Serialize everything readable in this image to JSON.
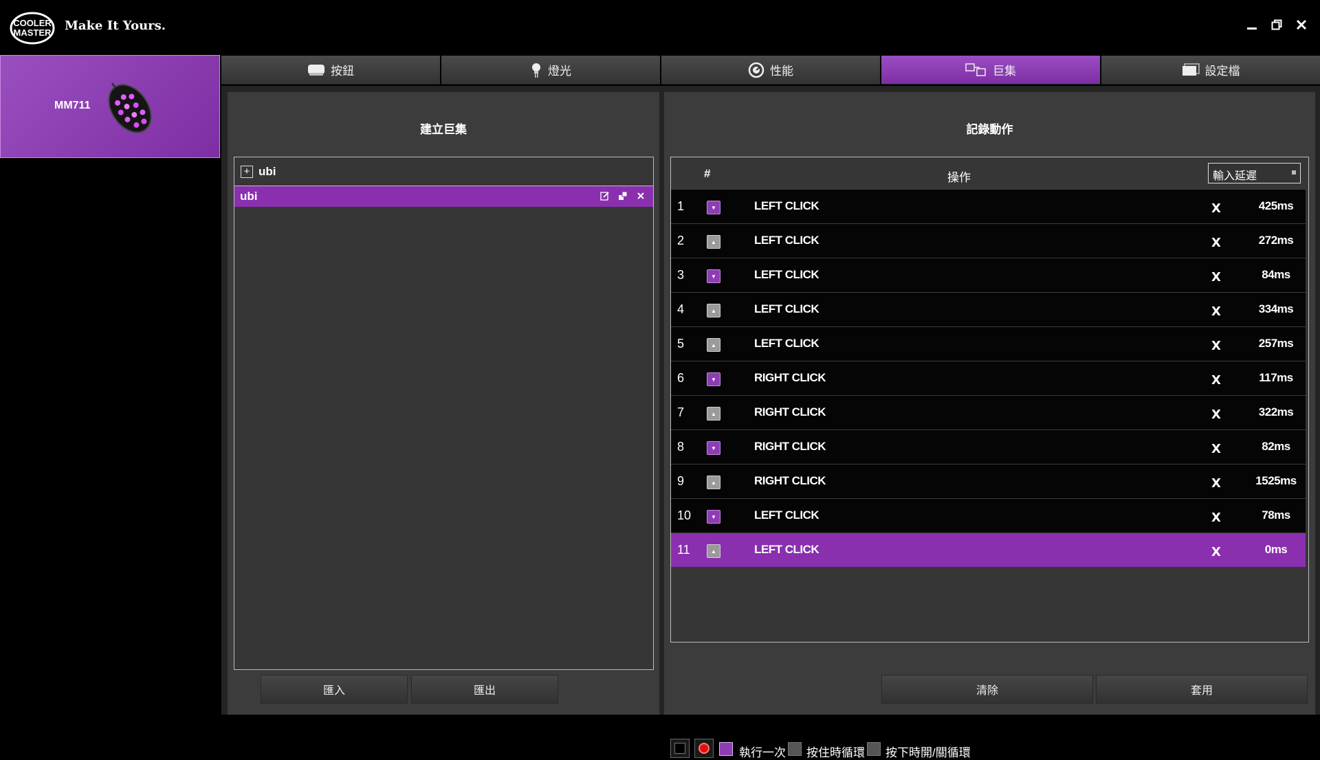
{
  "header": {
    "brand_line1": "COOLER",
    "brand_line2": "MASTER",
    "tagline": "Make It Yours.",
    "window_controls": [
      "minimize-icon",
      "restore-icon",
      "close-icon"
    ]
  },
  "device": {
    "name": "MM711"
  },
  "tabs": [
    {
      "label": "按鈕",
      "icon": "button-icon",
      "active": false
    },
    {
      "label": "燈光",
      "icon": "lighting-icon",
      "active": false
    },
    {
      "label": "性能",
      "icon": "performance-icon",
      "active": false
    },
    {
      "label": "巨集",
      "icon": "macro-icon",
      "active": true
    },
    {
      "label": "設定檔",
      "icon": "profile-icon",
      "active": false
    }
  ],
  "left_panel": {
    "title": "建立巨集",
    "group_name": "ubi",
    "selected_macro": "ubi",
    "import_label": "匯入",
    "export_label": "匯出"
  },
  "right_panel": {
    "title": "記錄動作",
    "col_hash": "#",
    "col_action": "操作",
    "delay_select": "輸入延遲",
    "rows": [
      {
        "num": "1",
        "type": "down",
        "action": "LEFT CLICK",
        "delay": "425ms"
      },
      {
        "num": "2",
        "type": "up",
        "action": "LEFT CLICK",
        "delay": "272ms"
      },
      {
        "num": "3",
        "type": "down",
        "action": "LEFT CLICK",
        "delay": "84ms"
      },
      {
        "num": "4",
        "type": "up",
        "action": "LEFT CLICK",
        "delay": "334ms"
      },
      {
        "num": "5",
        "type": "up",
        "action": "LEFT CLICK",
        "delay": "257ms"
      },
      {
        "num": "6",
        "type": "down",
        "action": "RIGHT CLICK",
        "delay": "117ms"
      },
      {
        "num": "7",
        "type": "up",
        "action": "RIGHT CLICK",
        "delay": "322ms"
      },
      {
        "num": "8",
        "type": "down",
        "action": "RIGHT CLICK",
        "delay": "82ms"
      },
      {
        "num": "9",
        "type": "up",
        "action": "RIGHT CLICK",
        "delay": "1525ms"
      },
      {
        "num": "10",
        "type": "down",
        "action": "LEFT CLICK",
        "delay": "78ms"
      },
      {
        "num": "11",
        "type": "up",
        "action": "LEFT CLICK",
        "delay": "0ms",
        "selected": true
      }
    ],
    "delete_glyph": "X",
    "play_once_label": "執行一次",
    "hold_loop_label": "按住時循環",
    "toggle_loop_label": "按下時開/關循環",
    "clear_label": "清除",
    "apply_label": "套用"
  },
  "colors": {
    "accent": "#8a2fae",
    "panel": "#3c3c3c",
    "frame": "#242424"
  }
}
